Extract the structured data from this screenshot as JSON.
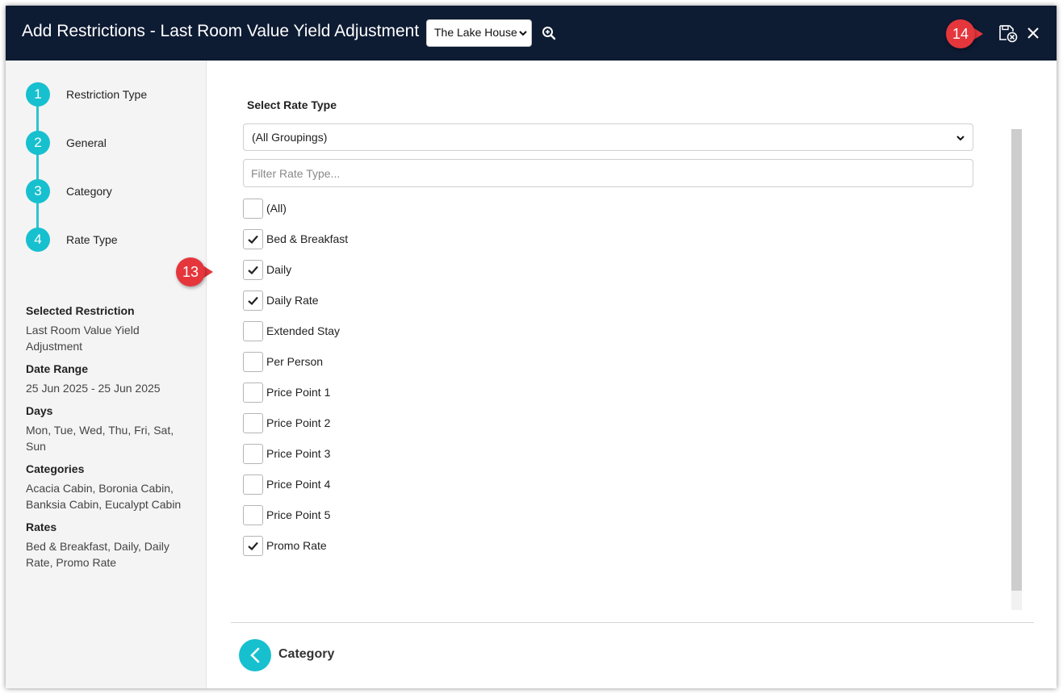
{
  "header": {
    "title": "Add Restrictions - Last Room Value Yield Adjustment",
    "property_select": "The Lake House"
  },
  "steps": [
    {
      "number": "1",
      "label": "Restriction Type"
    },
    {
      "number": "2",
      "label": "General"
    },
    {
      "number": "3",
      "label": "Category"
    },
    {
      "number": "4",
      "label": "Rate Type"
    }
  ],
  "summary": [
    {
      "heading": "Selected Restriction",
      "value": "Last Room Value Yield Adjustment"
    },
    {
      "heading": "Date Range",
      "value": "25 Jun 2025 - 25 Jun 2025"
    },
    {
      "heading": "Days",
      "value": "Mon, Tue, Wed, Thu, Fri, Sat, Sun"
    },
    {
      "heading": "Categories",
      "value": "Acacia Cabin, Boronia Cabin, Banksia Cabin, Eucalypt Cabin"
    },
    {
      "heading": "Rates",
      "value": "Bed & Breakfast, Daily, Daily Rate, Promo Rate"
    }
  ],
  "main": {
    "section_title": "Select Rate Type",
    "grouping_select": "(All Groupings)",
    "filter_placeholder": "Filter Rate Type...",
    "rate_types": [
      {
        "label": "(All)",
        "checked": false
      },
      {
        "label": "Bed & Breakfast",
        "checked": true
      },
      {
        "label": "Daily",
        "checked": true
      },
      {
        "label": "Daily Rate",
        "checked": true
      },
      {
        "label": "Extended Stay",
        "checked": false
      },
      {
        "label": "Per Person",
        "checked": false
      },
      {
        "label": "Price Point 1",
        "checked": false
      },
      {
        "label": "Price Point 2",
        "checked": false
      },
      {
        "label": "Price Point 3",
        "checked": false
      },
      {
        "label": "Price Point 4",
        "checked": false
      },
      {
        "label": "Price Point 5",
        "checked": false
      },
      {
        "label": "Promo Rate",
        "checked": true
      }
    ],
    "back_label": "Category"
  },
  "callouts": {
    "rate_callout": "13",
    "save_callout": "14"
  },
  "colors": {
    "header_bg": "#0d1b33",
    "accent": "#17c0cf",
    "callout": "#e5363c"
  },
  "icons": {
    "zoom": "zoom-in-icon",
    "save": "save-cancel-icon",
    "close": "close-icon",
    "back": "chevron-left-icon",
    "check": "checkmark-icon"
  }
}
